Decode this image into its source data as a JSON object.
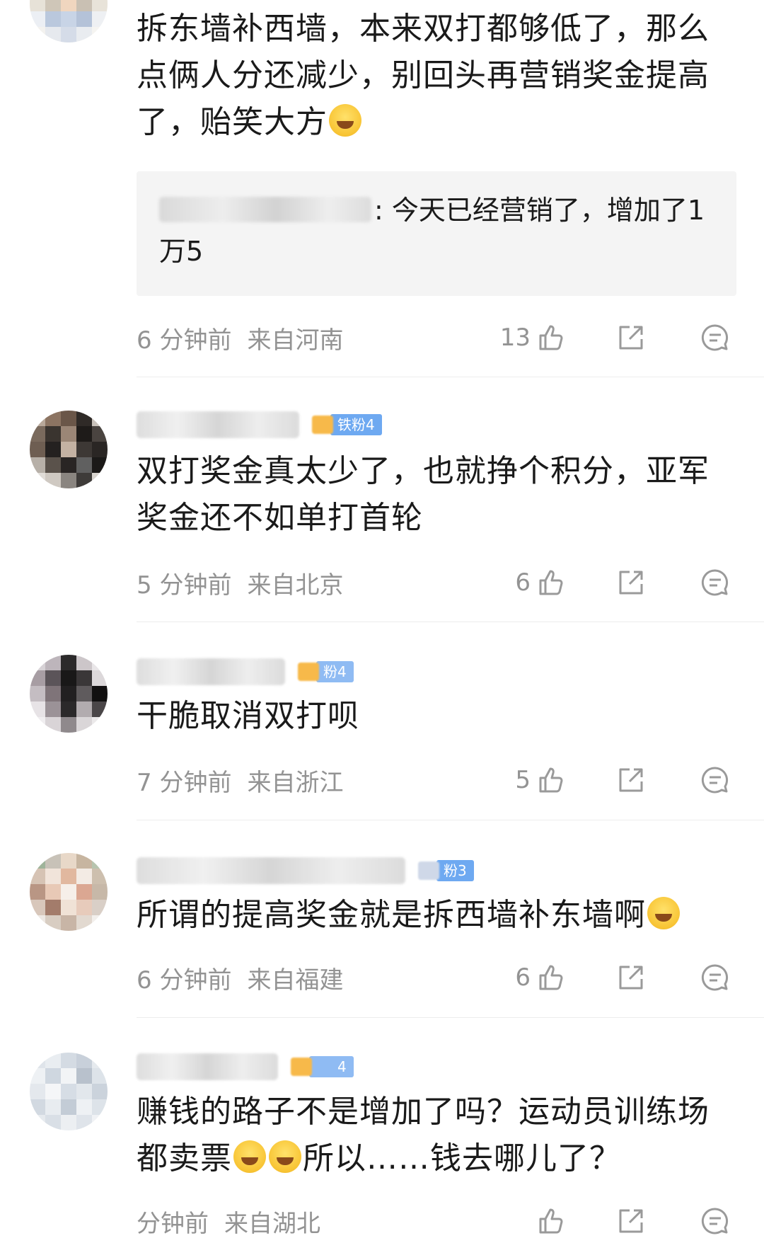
{
  "comments": [
    {
      "text": "拆东墙补西墙，本来双打都够低了，那么点俩人分还减少，别回头再营销奖金提高了，贻笑大方",
      "emoji": "grimace-face",
      "reply": {
        "text": ": 今天已经营销了，增加了1万5"
      },
      "time": "6 分钟前",
      "location": "来自河南",
      "likes": "13"
    },
    {
      "badge": "铁粉4",
      "text": "双打奖金真太少了，也就挣个积分，亚军奖金还不如单打首轮",
      "time": "5 分钟前",
      "location": "来自北京",
      "likes": "6"
    },
    {
      "badge": "粉4",
      "text": "干脆取消双打呗",
      "time": "7 分钟前",
      "location": "来自浙江",
      "likes": "5"
    },
    {
      "badge": "粉3",
      "text": "所谓的提高奖金就是拆西墙补东墙啊",
      "emoji": "tears-of-joy-face",
      "time": "6 分钟前",
      "location": "来自福建",
      "likes": "6"
    },
    {
      "badge": "4",
      "text_a": "赚钱的路子不是增加了吗？运动员训练场都卖票",
      "text_b": "所以……钱去哪儿了？",
      "emoji": "tears-of-joy-face",
      "time": "分钟前",
      "location": "来自湖北"
    }
  ],
  "icons": {
    "like": "thumbs-up-icon",
    "share": "share-icon",
    "reply": "comment-icon"
  },
  "colors": {
    "meta_text": "#939393",
    "reply_bg": "#f4f4f4",
    "badge_blue": "#6ea9f1",
    "badge_gold": "#f7b94a"
  }
}
